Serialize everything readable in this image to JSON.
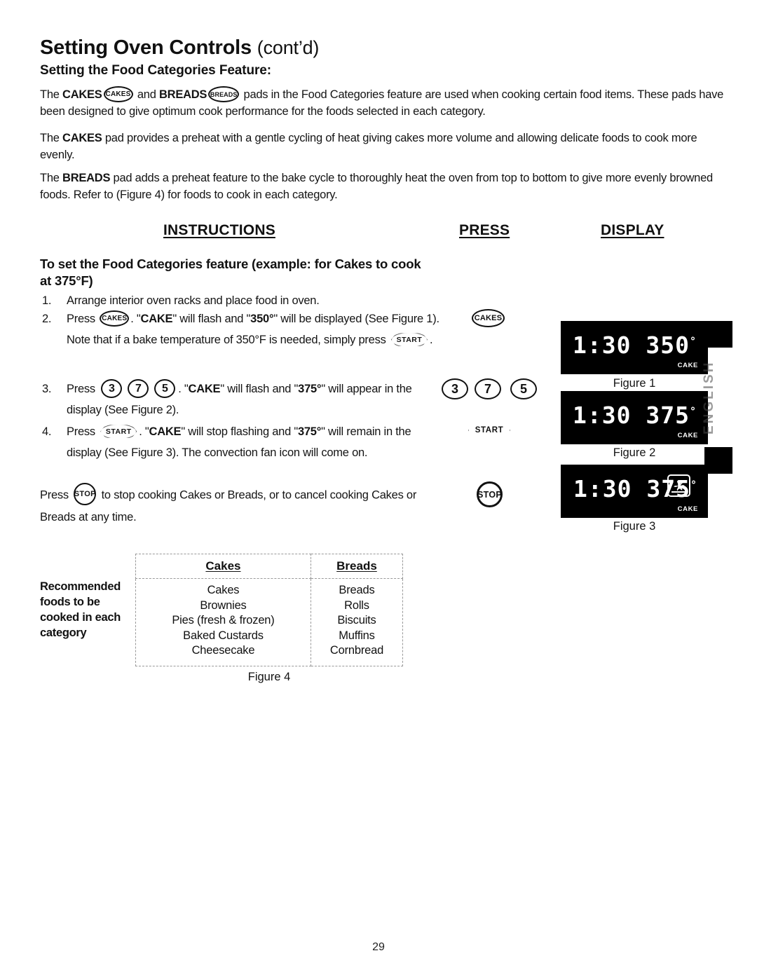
{
  "document": {
    "title_main": "Setting Oven Controls",
    "title_contd": "(cont’d)",
    "subtitle": "Setting the Food Categories Feature:",
    "page_number": "29",
    "side_tab": "ENGLISH"
  },
  "paragraphs": {
    "p1_a": "The ",
    "p1_cakes": "CAKES",
    "p1_pad_cakes": "CAKES",
    "p1_b": " and ",
    "p1_breads": "BREADS",
    "p1_pad_breads": "BREADS",
    "p1_c": " pads in the Food Categories feature are used when cooking certain food items. These pads have been designed to give optimum cook performance for the foods selected in each category.",
    "p2_a": "The ",
    "p2_bold": "CAKES",
    "p2_b": " pad provides a preheat with a gentle cycling of heat giving cakes more volume and allowing delicate foods to cook more evenly.",
    "p3_a": "The ",
    "p3_bold": "BREADS",
    "p3_b": " pad adds a preheat feature to the bake cycle to thoroughly heat the oven from top to bottom to give more evenly browned foods. Refer to (Figure 4) for foods to cook in each category."
  },
  "columns": {
    "instructions": "INSTRUCTIONS",
    "press": "PRESS",
    "display": "DISPLAY"
  },
  "instructions": {
    "heading": "To set the Food Categories feature (example: for Cakes to cook at 375°F)",
    "step1": {
      "num": "1.",
      "text": "Arrange interior oven racks and place food in oven."
    },
    "step2": {
      "num": "2.",
      "a": "Press ",
      "pad": "CAKES",
      "b": ". \"",
      "cake": "CAKE",
      "c": "\" will flash and \"",
      "temp": "350°",
      "d": "\" will be displayed (See Figure 1). Note that if a bake temperature of 350°F is needed, simply press ",
      "pad2": "START",
      "e": "."
    },
    "step3": {
      "num": "3.",
      "a": "Press ",
      "n1": "3",
      "n2": "7",
      "n3": "5",
      "b": ". \"",
      "cake": "CAKE",
      "c": "\" will flash and \"",
      "temp": "375°",
      "d": "\" will appear in the display (See Figure 2)."
    },
    "step4": {
      "num": "4.",
      "a": "Press ",
      "pad": "START",
      "b": ". \"",
      "cake": "CAKE",
      "c": "\" will stop flashing and \"",
      "temp": "375°",
      "d": "\" will remain in the display (See Figure 3). The convection fan icon will come on."
    },
    "step5": {
      "a": "Press ",
      "pad": "STOP",
      "b": " to stop cooking Cakes or Breads, or to cancel cooking Cakes or Breads at any time."
    }
  },
  "press_column": {
    "cakes_pad": "CAKES",
    "num_pads": [
      "3",
      "7",
      "5"
    ],
    "start_pad": "START",
    "stop_pad": "STOP"
  },
  "displays": [
    {
      "time": "1:30",
      "temp": "350",
      "degree": "°",
      "indicator": "CAKE",
      "fan_icon": false,
      "caption": "Figure 1"
    },
    {
      "time": "1:30",
      "temp": "375",
      "degree": "°",
      "indicator": "CAKE",
      "fan_icon": false,
      "caption": "Figure 2"
    },
    {
      "time": "1:30",
      "temp": "375",
      "degree": "°",
      "indicator": "CAKE",
      "fan_icon": true,
      "caption": "Figure 3"
    }
  ],
  "figure4": {
    "row_label": "Recommended foods to be cooked in each category",
    "headers": [
      "Cakes",
      "Breads"
    ],
    "cakes_items": [
      "Cakes",
      "Brownies",
      "Pies (fresh & frozen)",
      "Baked Custards",
      "Cheesecake"
    ],
    "breads_items": [
      "Breads",
      "Rolls",
      "Biscuits",
      "Muffins",
      "Cornbread"
    ],
    "caption": "Figure 4"
  },
  "colors": {
    "text": "#141414",
    "lcd_background": "#000000",
    "lcd_text": "#ffffff",
    "table_border": "#999999"
  }
}
